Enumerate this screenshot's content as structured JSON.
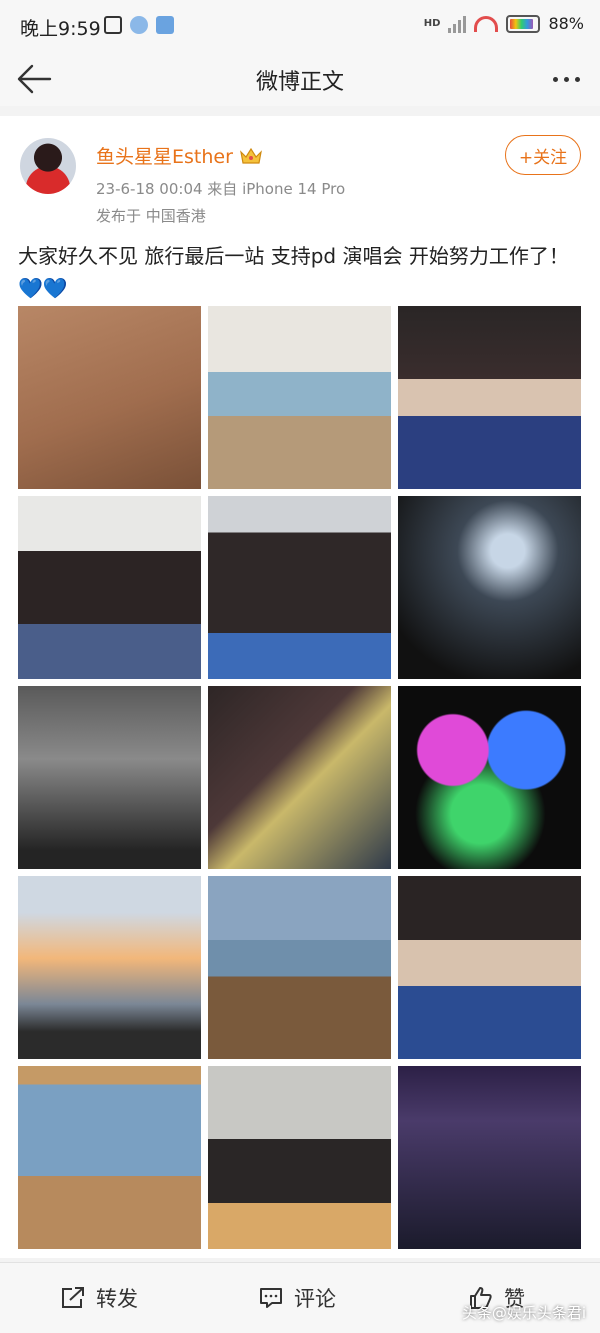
{
  "status_bar": {
    "time": "晚上9:59",
    "network": "HD",
    "battery_pct": "88%",
    "battery_level": 0.88
  },
  "nav": {
    "title": "微博正文",
    "back_icon": "arrow-left-icon",
    "more_icon": "more-dots-icon"
  },
  "post": {
    "author": "鱼头星星Esther",
    "author_color": "#e8731a",
    "badge_icon": "crown-icon",
    "meta": "23-6-18 00:04  来自 iPhone 14 Pro",
    "location": "发布于 中国香港",
    "follow_label": "+关注",
    "text": "大家好久不见 旅行最后一站 支持pd 演唱会 开始努力工作了！",
    "emoji": "💙💙",
    "photos": [
      "photo-1",
      "photo-2",
      "photo-3",
      "photo-4",
      "photo-5",
      "photo-6",
      "photo-7",
      "photo-8",
      "photo-9",
      "photo-10",
      "photo-11",
      "photo-12",
      "photo-13",
      "photo-14",
      "photo-15"
    ]
  },
  "actions": {
    "repost": "转发",
    "comment": "评论",
    "like": "赞"
  },
  "watermark": "头条@娱乐头条君i"
}
